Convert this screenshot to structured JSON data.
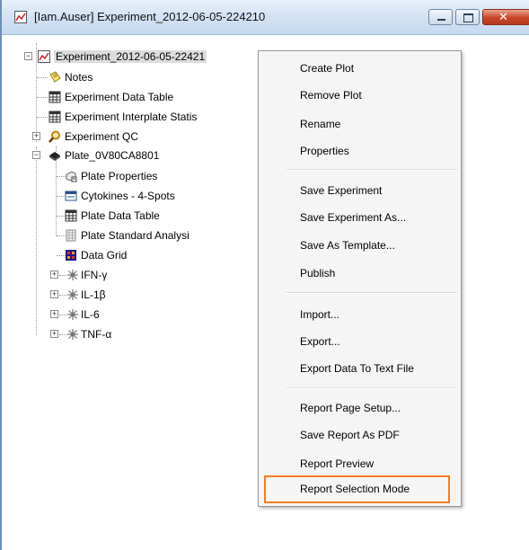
{
  "window": {
    "title": "[Iam.Auser] Experiment_2012-06-05-224210",
    "controls": {
      "minimize": "minimize",
      "maximize": "maximize",
      "close": "close"
    }
  },
  "tree": {
    "root": "Experiment_2012-06-05-22421",
    "items": {
      "notes": "Notes",
      "experiment_data_table": "Experiment Data Table",
      "experiment_interplate": "Experiment Interplate Statis",
      "experiment_qc": "Experiment QC",
      "plate": "Plate_0V80CA8801",
      "plate_properties": "Plate Properties",
      "cytokines": "Cytokines - 4-Spots",
      "plate_data_table": "Plate Data Table",
      "plate_standard": "Plate Standard Analysi",
      "data_grid": "Data Grid",
      "ifn": "IFN-γ",
      "il1": "IL-1β",
      "il6": "IL-6",
      "tnf": "TNF-α"
    }
  },
  "context_menu": {
    "items": [
      "Create Plot",
      "Remove Plot",
      "Rename",
      "Properties",
      "Save Experiment",
      "Save Experiment As...",
      "Save As Template...",
      "Publish",
      "Import...",
      "Export...",
      "Export Data To Text File",
      "Report Page Setup...",
      "Save Report As PDF",
      "Report Preview",
      "Report Selection Mode"
    ],
    "highlighted_item": "Report Selection Mode",
    "highlight_color": "#f07d25"
  }
}
